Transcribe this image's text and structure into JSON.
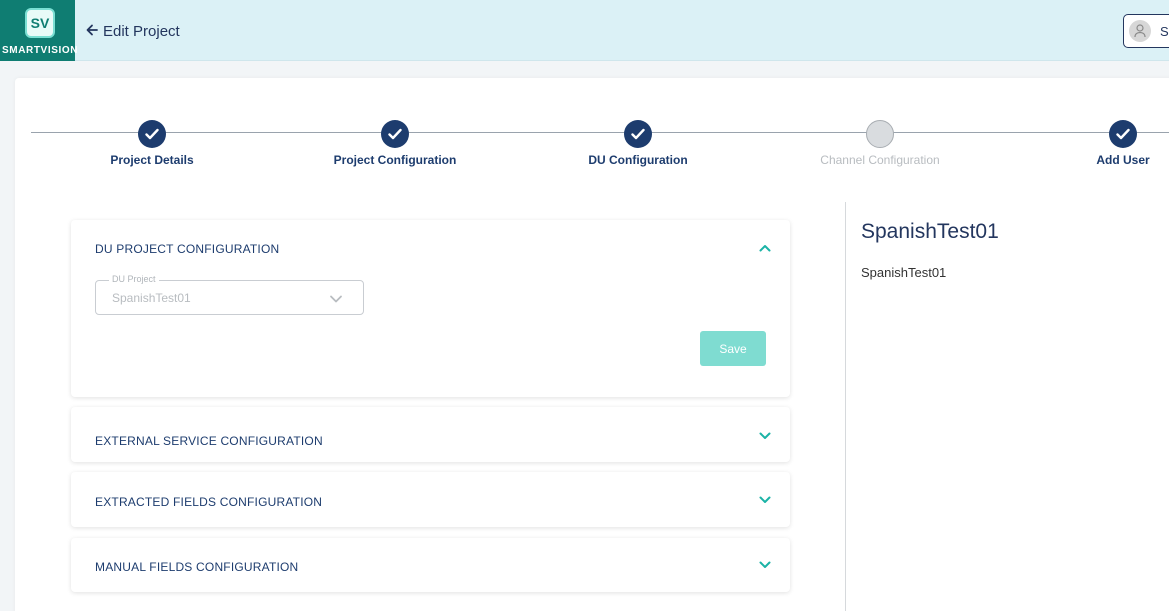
{
  "header": {
    "logo_badge": "SV",
    "logo_text": "SMARTVISION",
    "back_label": "Edit Project",
    "user_name": "Sa"
  },
  "stepper": {
    "steps": [
      {
        "label": "Project Details",
        "status": "done"
      },
      {
        "label": "Project Configuration",
        "status": "done"
      },
      {
        "label": "DU Configuration",
        "status": "done"
      },
      {
        "label": "Channel Configuration",
        "status": "pending"
      },
      {
        "label": "Add User",
        "status": "done"
      }
    ]
  },
  "sections": {
    "du_project": {
      "title": "DU PROJECT CONFIGURATION",
      "field_label": "DU Project",
      "field_value": "SpanishTest01",
      "save_label": "Save"
    },
    "external_service": {
      "title": "EXTERNAL SERVICE CONFIGURATION"
    },
    "extracted_fields": {
      "title": "EXTRACTED FIELDS CONFIGURATION"
    },
    "manual_fields": {
      "title": "MANUAL FIELDS CONFIGURATION"
    }
  },
  "info": {
    "title": "SpanishTest01",
    "subtitle": "SpanishTest01"
  },
  "colors": {
    "header_bg": "#dbf1f6",
    "logo_bg": "#0f7d72",
    "primary": "#1d3c6e",
    "accent": "#1bb3a6",
    "save_button": "#7fdcd1"
  }
}
